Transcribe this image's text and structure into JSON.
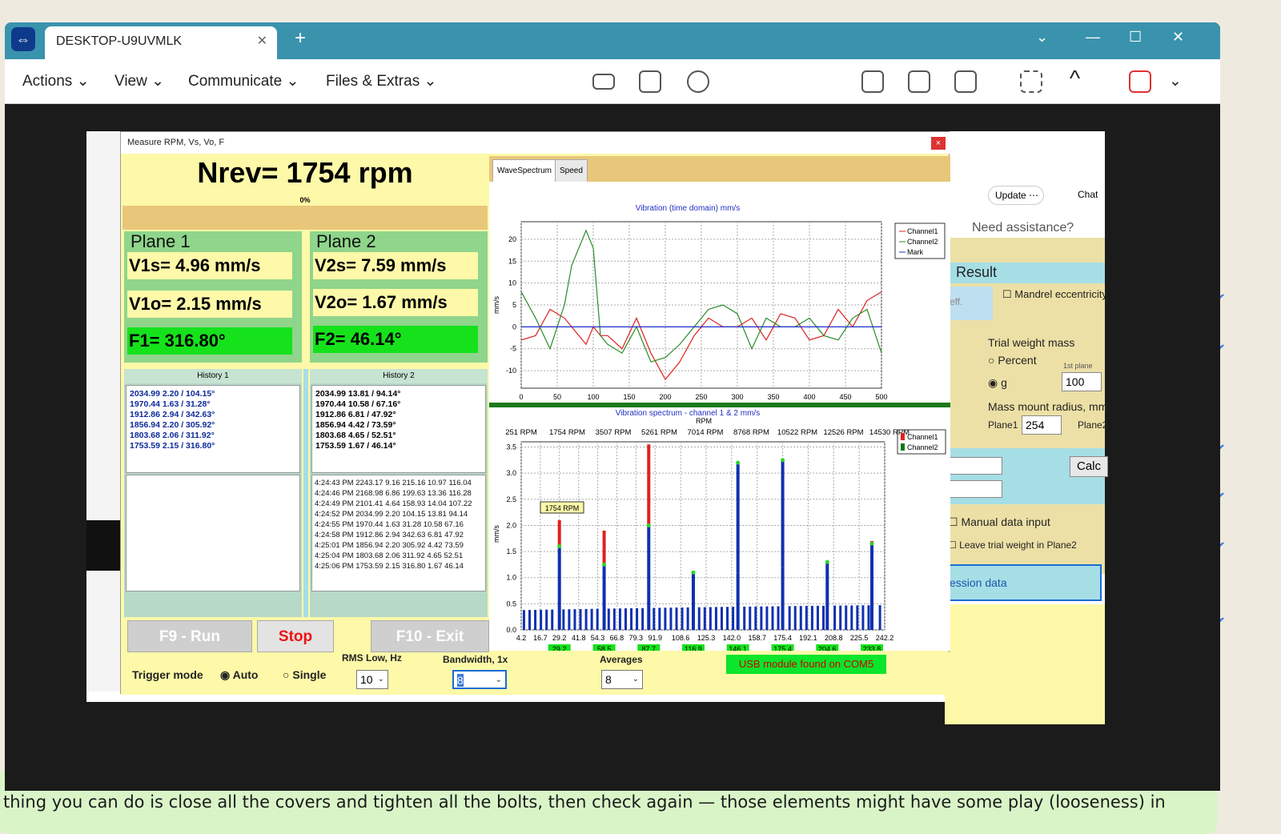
{
  "window": {
    "tab_title": "DESKTOP-U9UVMLK",
    "menu": [
      "Actions",
      "View",
      "Communicate",
      "Files & Extras"
    ],
    "toolbar_icons": [
      "remote-keyboard-icon",
      "file-transfer-icon",
      "session-restart-icon",
      "clipboard-icon",
      "whiteboard-icon",
      "screenshot-icon",
      "fullscreen-icon",
      "collapse-icon",
      "end-session-icon"
    ]
  },
  "app": {
    "title": "Measure RPM, Vs, Vo, F",
    "nrev": "Nrev= 1754 rpm",
    "progress": "0%",
    "plane1": {
      "title": "Plane 1",
      "vs": "V1s= 4.96 mm/s",
      "vo": "V1o= 2.15 mm/s",
      "f": "F1= 316.80°"
    },
    "plane2": {
      "title": "Plane 2",
      "vs": "V2s= 7.59 mm/s",
      "vo": "V2o= 1.67 mm/s",
      "f": "F2= 46.14°"
    },
    "history1": {
      "title": "History 1",
      "rows": [
        "2034.99 2.20 / 104.15°",
        "1970.44 1.63 / 31.28°",
        "1912.86 2.94 / 342.63°",
        "1856.94 2.20 / 305.92°",
        "1803.68 2.06 / 311.92°",
        "1753.59 2.15 / 316.80°"
      ]
    },
    "history2": {
      "title": "History 2",
      "rows": [
        "2034.99 13.81 / 94.14°",
        "1970.44 10.58 / 67.16°",
        "1912.86 6.81 / 47.92°",
        "1856.94 4.42 / 73.59°",
        "1803.68 4.65 / 52.51°",
        "1753.59 1.67 / 46.14°"
      ],
      "log": [
        "4:24:43 PM 2243.17 9.16 215.16 10.97 116.04",
        "4:24:46 PM 2168.98 6.86 199.63 13.36 116.28",
        "4:24:49 PM 2101.41 4.64 158.93 14.04 107.22",
        "4:24:52 PM 2034.99 2.20 104.15 13.81 94.14",
        "4:24:55 PM 1970.44 1.63 31.28 10.58 67.16",
        "4:24:58 PM 1912.86 2.94 342.63 6.81 47.92",
        "4:25:01 PM 1856.94 2.20 305.92 4.42 73.59",
        "4:25:04 PM 1803.68 2.06 311.92 4.65 52.51",
        "4:25:06 PM 1753.59 2.15 316.80 1.67 46.14"
      ]
    },
    "buttons": {
      "run": "F9 - Run",
      "stop": "Stop",
      "exit": "F10 - Exit"
    },
    "trigger": {
      "label": "Trigger mode",
      "auto": "Auto",
      "single": "Single"
    },
    "rms": {
      "label": "RMS Low, Hz",
      "value": "10"
    },
    "bandwidth": {
      "label": "Bandwidth, 1x",
      "value": "8"
    },
    "averages": {
      "label": "Averages",
      "value": "8"
    },
    "usb_status": "USB module found on COM5",
    "tabs": [
      "WaveSpectrum",
      "Speed"
    ]
  },
  "chart_data": [
    {
      "type": "line",
      "title": "Vibration (time domain) mm/s",
      "ylabel": "mm/s",
      "xlim": [
        0,
        500
      ],
      "ylim": [
        -14,
        24
      ],
      "xticks": [
        0,
        50,
        100,
        150,
        200,
        250,
        300,
        350,
        400,
        450,
        500
      ],
      "yticks": [
        -10,
        -5,
        0,
        5,
        10,
        15,
        20
      ],
      "grid": true,
      "legend": "top-right",
      "x": [
        0,
        20,
        40,
        60,
        70,
        90,
        100,
        110,
        120,
        140,
        160,
        180,
        200,
        220,
        240,
        260,
        280,
        300,
        320,
        340,
        360,
        380,
        400,
        420,
        440,
        460,
        480,
        500
      ],
      "series": [
        {
          "name": "Channel1",
          "color": "#e02020",
          "values": [
            -3,
            -2,
            4,
            2,
            0,
            -4,
            0,
            -2,
            -2,
            -5,
            2,
            -6,
            -12,
            -8,
            -2,
            2,
            0,
            0,
            2,
            -3,
            3,
            2,
            -3,
            -2,
            4,
            0,
            6,
            8
          ]
        },
        {
          "name": "Channel2",
          "color": "#2a8a2a",
          "values": [
            8,
            2,
            -5,
            5,
            14,
            22,
            18,
            -2,
            -4,
            -6,
            0,
            -8,
            -7,
            -4,
            0,
            4,
            5,
            3,
            -5,
            2,
            0,
            0,
            2,
            -2,
            -3,
            2,
            4,
            -6
          ]
        },
        {
          "name": "Mark",
          "color": "#2030d0",
          "values": [
            0,
            0,
            0,
            0,
            0,
            0,
            0,
            0,
            0,
            0,
            0,
            0,
            0,
            0,
            0,
            0,
            0,
            0,
            0,
            0,
            0,
            0,
            0,
            0,
            0,
            0,
            0,
            0
          ]
        }
      ]
    },
    {
      "type": "bar",
      "title": "Vibration spectrum  - channel 1 & 2 mm/s",
      "xlabel": "RPM",
      "ylabel": "mm/s",
      "ylim": [
        0,
        3.6
      ],
      "yticks": [
        0.0,
        0.5,
        1.0,
        1.5,
        2.0,
        2.5,
        3.0,
        3.5
      ],
      "rpm_ticks": [
        "251 RPM",
        "1754 RPM",
        "3507 RPM",
        "5261 RPM",
        "7014 RPM",
        "8768 RPM",
        "10522 RPM",
        "12526 RPM",
        "14530 RPM"
      ],
      "xticks": [
        "4.2",
        "16.7",
        "29.2",
        "41.8",
        "54.3",
        "66.8",
        "79.3",
        "91.9",
        "108.6",
        "125.3",
        "142.0",
        "158.7",
        "175.4",
        "192.1",
        "208.8",
        "225.5",
        "242.2"
      ],
      "peak_labels": [
        "29.2",
        "58.5",
        "87.7",
        "116.9",
        "146.1",
        "175.4",
        "204.6",
        "233.8"
      ],
      "annotation": "1754 RPM",
      "legend": "top-right",
      "series": [
        {
          "name": "Channel1",
          "color": "#e02020",
          "values": [
            2.1,
            1.9,
            3.55,
            1.1,
            1.1,
            1.2,
            1.3,
            1.7
          ]
        },
        {
          "name": "Channel2",
          "color": "#0d7a12",
          "values": [
            1.6,
            1.25,
            2.0,
            1.1,
            3.2,
            3.25,
            1.3,
            1.65
          ]
        }
      ],
      "peak_x": [
        29.2,
        58.5,
        87.7,
        116.9,
        146.1,
        175.4,
        204.6,
        233.8
      ]
    }
  ],
  "background_app": {
    "update": "Update",
    "chat": "Chat",
    "assist": "Need assistance?",
    "result": "Result",
    "mandrel": "Mandrel eccentricity",
    "eff": "eff.",
    "trial_weight": "Trial weight mass",
    "percent": "Percent",
    "g": "g",
    "first_plane": "1st plane",
    "trial_value": "100",
    "mass_mount": "Mass mount radius, mm",
    "plane1_label": "Plane1",
    "plane1_value": "254",
    "plane2_label": "Plane2",
    "calc": "Calc",
    "manual": "Manual data input",
    "leave_trial": "Leave trial weight in Plane2",
    "session": "ession data"
  },
  "chat_text": "thing you can do is close all the covers and tighten all the bolts, then check again — those elements might have some play (looseness) in"
}
